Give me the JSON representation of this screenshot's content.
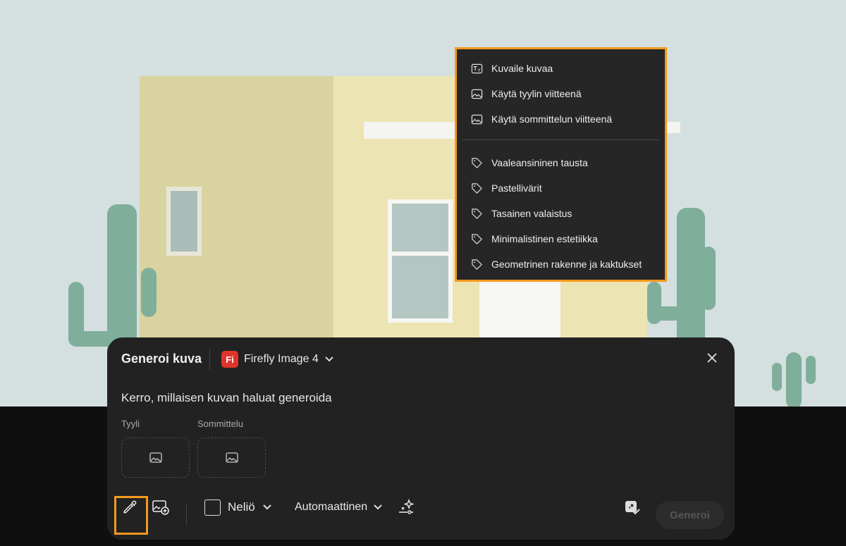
{
  "menu": {
    "actions": [
      {
        "label": "Kuvaile kuvaa",
        "icon": "text-describe-icon"
      },
      {
        "label": "Käytä tyylin viitteenä",
        "icon": "image-icon"
      },
      {
        "label": "Käytä sommittelun viitteenä",
        "icon": "image-icon"
      }
    ],
    "tags": [
      {
        "label": "Vaaleansininen tausta",
        "icon": "tag-icon"
      },
      {
        "label": "Pastellivärit",
        "icon": "tag-icon"
      },
      {
        "label": "Tasainen valaistus",
        "icon": "tag-icon"
      },
      {
        "label": "Minimalistinen estetiikka",
        "icon": "tag-icon"
      },
      {
        "label": "Geometrinen rakenne ja kaktukset",
        "icon": "tag-icon"
      }
    ]
  },
  "panel": {
    "title": "Generoi kuva",
    "model_badge": "Fi",
    "model": "Firefly Image 4",
    "prompt_placeholder": "Kerro, millaisen kuvan haluat generoida",
    "style_label": "Tyyli",
    "composition_label": "Sommittelu",
    "aspect_ratio": "Neliö",
    "content_type": "Automaattinen",
    "generate_label": "Generoi"
  },
  "colors": {
    "highlight": "#f39a1e",
    "firefly": "#e0342a"
  }
}
